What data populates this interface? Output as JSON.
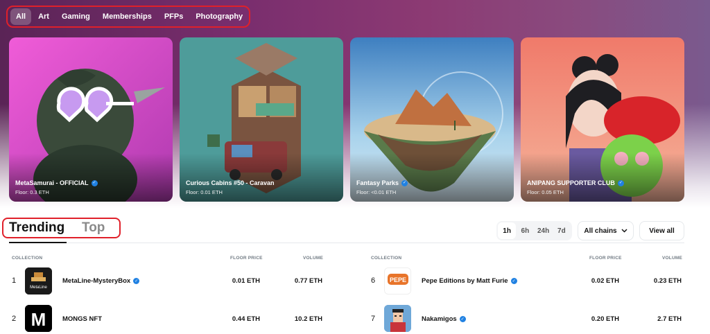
{
  "categories": [
    "All",
    "Art",
    "Gaming",
    "Memberships",
    "PFPs",
    "Photography"
  ],
  "cards": [
    {
      "title": "MetaSamurai - OFFICIAL",
      "floor": "Floor: 0.3 ETH",
      "verified": true
    },
    {
      "title": "Curious Cabins #50 - Caravan",
      "floor": "Floor: 0.01 ETH",
      "verified": false
    },
    {
      "title": "Fantasy Parks",
      "floor": "Floor: <0.01 ETH",
      "verified": true
    },
    {
      "title": "ANIPANG SUPPORTER CLUB",
      "floor": "Floor: 0.05 ETH",
      "verified": true
    }
  ],
  "section_tabs": {
    "trending": "Trending",
    "top": "Top"
  },
  "time_filters": [
    "1h",
    "6h",
    "24h",
    "7d"
  ],
  "active_time": "1h",
  "chains_label": "All chains",
  "view_all_label": "View all",
  "columns": {
    "collection": "COLLECTION",
    "floor": "FLOOR PRICE",
    "volume": "VOLUME"
  },
  "rows_left": [
    {
      "rank": "1",
      "name": "MetaLine-MysteryBox",
      "verified": true,
      "floor": "0.01 ETH",
      "volume": "0.77 ETH",
      "thumb_text": "MetaLine"
    },
    {
      "rank": "2",
      "name": "MONGS NFT",
      "verified": false,
      "floor": "0.44 ETH",
      "volume": "10.2 ETH",
      "thumb_text": "M"
    }
  ],
  "rows_right": [
    {
      "rank": "6",
      "name": "Pepe Editions by Matt Furie",
      "verified": true,
      "floor": "0.02 ETH",
      "volume": "0.23 ETH",
      "thumb_text": "PEPE"
    },
    {
      "rank": "7",
      "name": "Nakamigos",
      "verified": true,
      "floor": "0.20 ETH",
      "volume": "2.7 ETH",
      "thumb_text": ""
    }
  ],
  "colors": {
    "accent_red": "#e0202a",
    "verified_blue": "#2081e2",
    "hero_purple": "#7a2e6e"
  }
}
